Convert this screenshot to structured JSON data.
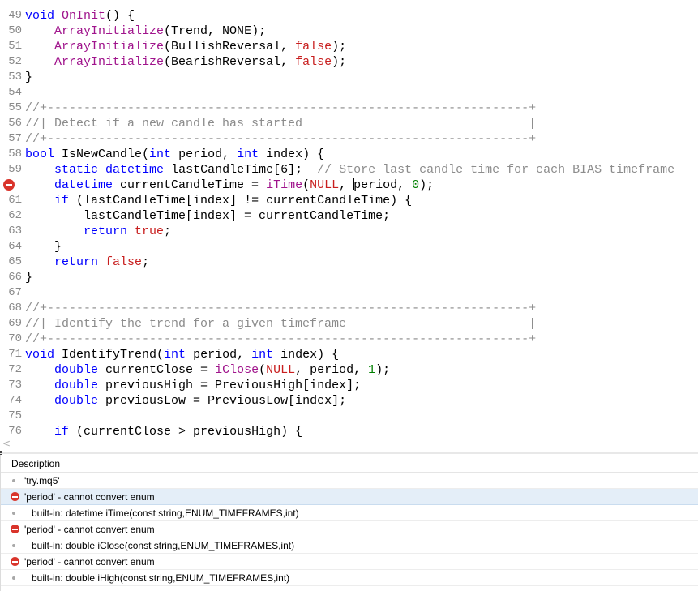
{
  "editor": {
    "lines": [
      {
        "num": "49",
        "tokens": [
          {
            "t": "void",
            "c": "#0000ff"
          },
          {
            "t": " "
          },
          {
            "t": "OnInit",
            "c": "#a0148c"
          },
          {
            "t": "() {"
          }
        ]
      },
      {
        "num": "50",
        "tokens": [
          {
            "t": "    "
          },
          {
            "t": "ArrayInitialize",
            "c": "#a0148c"
          },
          {
            "t": "(Trend, NONE);"
          }
        ]
      },
      {
        "num": "51",
        "tokens": [
          {
            "t": "    "
          },
          {
            "t": "ArrayInitialize",
            "c": "#a0148c"
          },
          {
            "t": "(BullishReversal, "
          },
          {
            "t": "false",
            "c": "#c81e1e"
          },
          {
            "t": ");"
          }
        ]
      },
      {
        "num": "52",
        "tokens": [
          {
            "t": "    "
          },
          {
            "t": "ArrayInitialize",
            "c": "#a0148c"
          },
          {
            "t": "(BearishReversal, "
          },
          {
            "t": "false",
            "c": "#c81e1e"
          },
          {
            "t": ");"
          }
        ]
      },
      {
        "num": "53",
        "tokens": [
          {
            "t": "}"
          }
        ]
      },
      {
        "num": "54",
        "tokens": []
      },
      {
        "num": "55",
        "tokens": [
          {
            "t": "//+------------------------------------------------------------------+",
            "c": "#8c8c8c"
          }
        ]
      },
      {
        "num": "56",
        "tokens": [
          {
            "t": "//| Detect if a new candle has started                               |",
            "c": "#8c8c8c"
          }
        ]
      },
      {
        "num": "57",
        "tokens": [
          {
            "t": "//+------------------------------------------------------------------+",
            "c": "#8c8c8c"
          }
        ]
      },
      {
        "num": "58",
        "tokens": [
          {
            "t": "bool",
            "c": "#0000ff"
          },
          {
            "t": " IsNewCandle("
          },
          {
            "t": "int",
            "c": "#0000ff"
          },
          {
            "t": " period, "
          },
          {
            "t": "int",
            "c": "#0000ff"
          },
          {
            "t": " index) {"
          }
        ]
      },
      {
        "num": "59",
        "tokens": [
          {
            "t": "    "
          },
          {
            "t": "static",
            "c": "#0000ff"
          },
          {
            "t": " "
          },
          {
            "t": "datetime",
            "c": "#0000ff"
          },
          {
            "t": " lastCandleTime[6];  "
          },
          {
            "t": "// Store last candle time for each BIAS timeframe",
            "c": "#8c8c8c"
          }
        ]
      },
      {
        "num": "60",
        "error": true,
        "tokens": [
          {
            "t": "    "
          },
          {
            "t": "datetime",
            "c": "#0000ff"
          },
          {
            "t": " currentCandleTime = "
          },
          {
            "t": "iTime",
            "c": "#a0148c"
          },
          {
            "t": "("
          },
          {
            "t": "NULL",
            "c": "#c81e1e"
          },
          {
            "t": ", "
          },
          {
            "caret": true
          },
          {
            "t": "period, "
          },
          {
            "t": "0",
            "c": "#008000"
          },
          {
            "t": ");"
          }
        ]
      },
      {
        "num": "61",
        "tokens": [
          {
            "t": "    "
          },
          {
            "t": "if",
            "c": "#0000ff"
          },
          {
            "t": " (lastCandleTime[index] != currentCandleTime) {"
          }
        ]
      },
      {
        "num": "62",
        "tokens": [
          {
            "t": "        lastCandleTime[index] = currentCandleTime;"
          }
        ]
      },
      {
        "num": "63",
        "tokens": [
          {
            "t": "        "
          },
          {
            "t": "return",
            "c": "#0000ff"
          },
          {
            "t": " "
          },
          {
            "t": "true",
            "c": "#c81e1e"
          },
          {
            "t": ";"
          }
        ]
      },
      {
        "num": "64",
        "tokens": [
          {
            "t": "    }"
          }
        ]
      },
      {
        "num": "65",
        "tokens": [
          {
            "t": "    "
          },
          {
            "t": "return",
            "c": "#0000ff"
          },
          {
            "t": " "
          },
          {
            "t": "false",
            "c": "#c81e1e"
          },
          {
            "t": ";"
          }
        ]
      },
      {
        "num": "66",
        "tokens": [
          {
            "t": "}"
          }
        ]
      },
      {
        "num": "67",
        "tokens": []
      },
      {
        "num": "68",
        "tokens": [
          {
            "t": "//+------------------------------------------------------------------+",
            "c": "#8c8c8c"
          }
        ]
      },
      {
        "num": "69",
        "tokens": [
          {
            "t": "//| Identify the trend for a given timeframe                         |",
            "c": "#8c8c8c"
          }
        ]
      },
      {
        "num": "70",
        "tokens": [
          {
            "t": "//+------------------------------------------------------------------+",
            "c": "#8c8c8c"
          }
        ]
      },
      {
        "num": "71",
        "tokens": [
          {
            "t": "void",
            "c": "#0000ff"
          },
          {
            "t": " IdentifyTrend("
          },
          {
            "t": "int",
            "c": "#0000ff"
          },
          {
            "t": " period, "
          },
          {
            "t": "int",
            "c": "#0000ff"
          },
          {
            "t": " index) {"
          }
        ]
      },
      {
        "num": "72",
        "tokens": [
          {
            "t": "    "
          },
          {
            "t": "double",
            "c": "#0000ff"
          },
          {
            "t": " currentClose = "
          },
          {
            "t": "iClose",
            "c": "#a0148c"
          },
          {
            "t": "("
          },
          {
            "t": "NULL",
            "c": "#c81e1e"
          },
          {
            "t": ", period, "
          },
          {
            "t": "1",
            "c": "#008000"
          },
          {
            "t": ");"
          }
        ]
      },
      {
        "num": "73",
        "tokens": [
          {
            "t": "    "
          },
          {
            "t": "double",
            "c": "#0000ff"
          },
          {
            "t": " previousHigh = PreviousHigh[index];"
          }
        ]
      },
      {
        "num": "74",
        "tokens": [
          {
            "t": "    "
          },
          {
            "t": "double",
            "c": "#0000ff"
          },
          {
            "t": " previousLow = PreviousLow[index];"
          }
        ]
      },
      {
        "num": "75",
        "tokens": []
      },
      {
        "num": "76",
        "tokens": [
          {
            "t": "    "
          },
          {
            "t": "if",
            "c": "#0000ff"
          },
          {
            "t": " (currentClose > previousHigh) {"
          }
        ]
      }
    ]
  },
  "scrollbar": {
    "left_arrow": "<"
  },
  "errors": {
    "header": "Description",
    "rows": [
      {
        "type": "file",
        "text": "'try.mq5'"
      },
      {
        "type": "error",
        "text": "'period' - cannot convert enum",
        "selected": true
      },
      {
        "type": "info",
        "text": "built-in: datetime iTime(const string,ENUM_TIMEFRAMES,int)"
      },
      {
        "type": "error",
        "text": "'period' - cannot convert enum"
      },
      {
        "type": "info",
        "text": "built-in: double iClose(const string,ENUM_TIMEFRAMES,int)"
      },
      {
        "type": "error",
        "text": "'period' - cannot convert enum"
      },
      {
        "type": "info",
        "text": "built-in: double iHigh(const string,ENUM_TIMEFRAMES,int)"
      }
    ]
  }
}
